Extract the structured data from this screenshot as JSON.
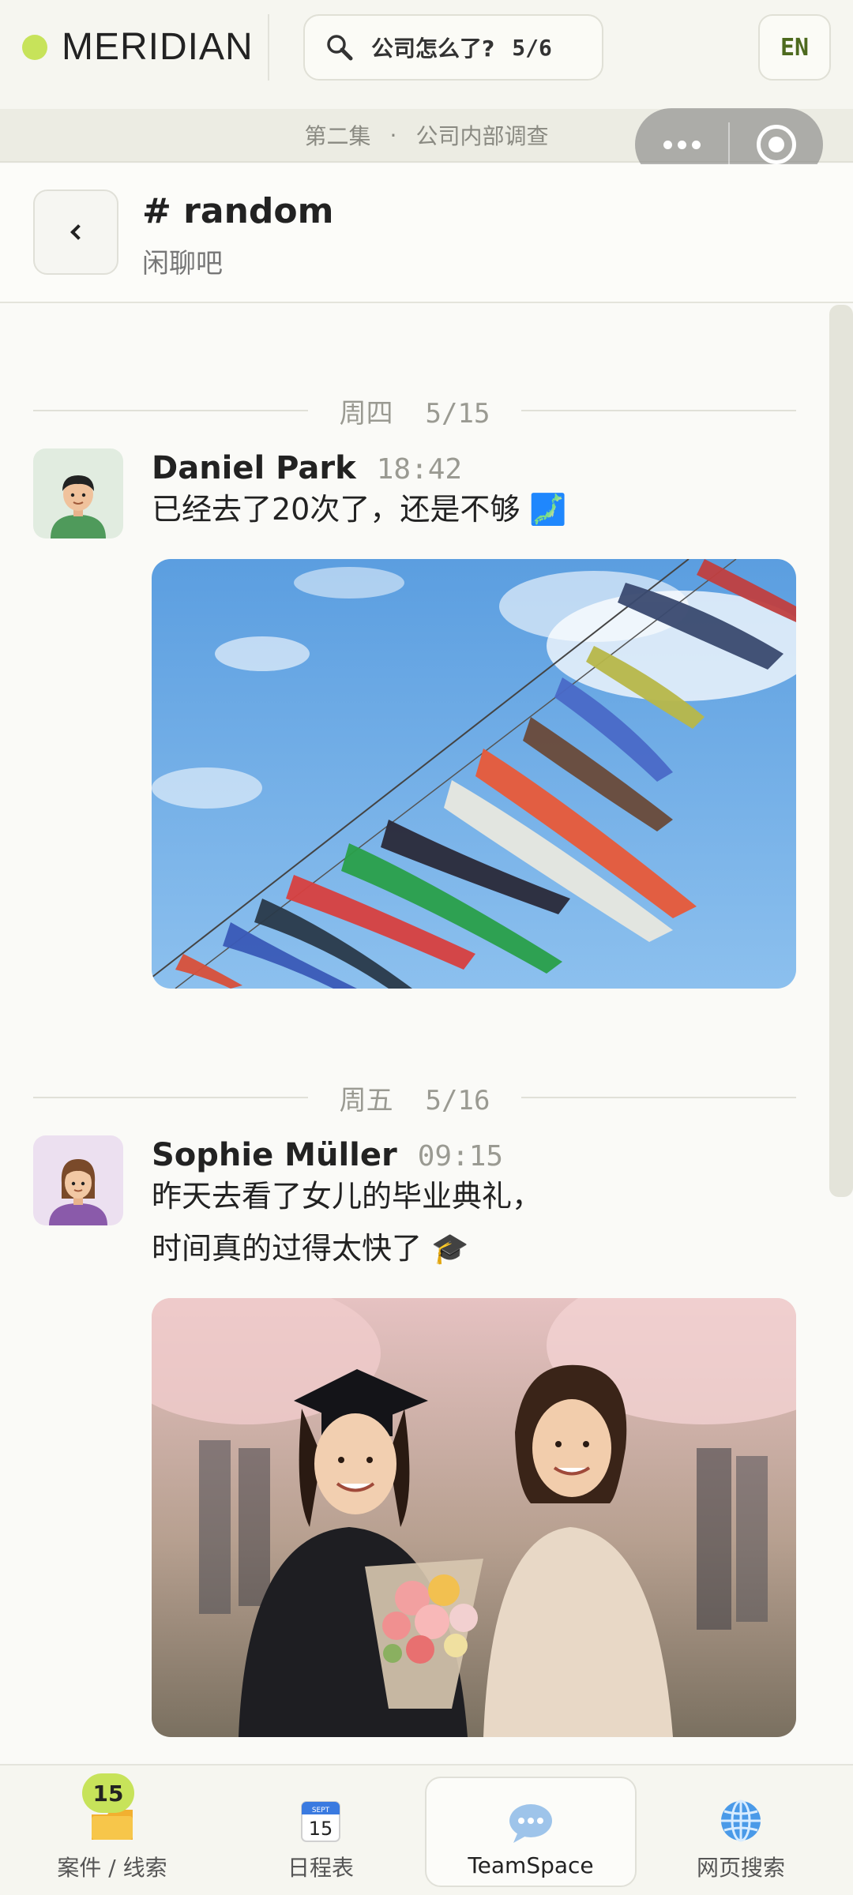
{
  "app": {
    "brand": "MERIDIAN",
    "search": {
      "query": "公司怎么了?",
      "count": "5/6"
    },
    "lang": "EN",
    "episode": {
      "part": "第二集",
      "separator": "·",
      "title": "公司内部调查"
    }
  },
  "channel": {
    "title": "# random",
    "subtitle": "闲聊吧"
  },
  "feed": {
    "days": [
      {
        "weekday": "周四",
        "date": "5/15"
      },
      {
        "weekday": "周五",
        "date": "5/16"
      }
    ],
    "messages": [
      {
        "author": "Daniel Park",
        "time": "18:42",
        "lines": [
          "已经去了20次了，还是不够 🗾"
        ],
        "image": "koinobori-streamers"
      },
      {
        "author": "Sophie Müller",
        "time": "09:15",
        "lines": [
          "昨天去看了女儿的毕业典礼，",
          "时间真的过得太快了 🎓"
        ],
        "image": "graduation-photo"
      }
    ]
  },
  "nav": {
    "items": [
      {
        "label": "案件 / 线索",
        "icon": "folder-icon",
        "badge": "15"
      },
      {
        "label": "日程表",
        "icon": "calendar-icon",
        "calendar_day": "15",
        "calendar_month": "SEPT"
      },
      {
        "label": "TeamSpace",
        "icon": "chat-bubble-icon",
        "active": true
      },
      {
        "label": "网页搜索",
        "icon": "globe-icon"
      }
    ]
  },
  "colors": {
    "accent": "#c7e35a",
    "lang_text": "#4d6a1e"
  }
}
